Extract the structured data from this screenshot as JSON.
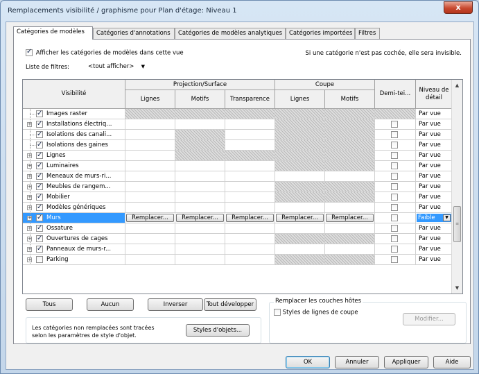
{
  "window": {
    "title": "Remplacements visibilité / graphisme pour Plan d'étage: Niveau 1",
    "close_glyph": "x"
  },
  "tabs": [
    {
      "label": "Catégories de modèles",
      "active": true
    },
    {
      "label": "Catégories d'annotations"
    },
    {
      "label": "Catégories de modèles analytiques"
    },
    {
      "label": "Catégories importées"
    },
    {
      "label": "Filtres"
    }
  ],
  "show_all": {
    "label": "Afficher les catégories de modèles dans cette vue",
    "checked": true
  },
  "hint": "Si une catégorie n'est pas cochée, elle sera invisible.",
  "filters": {
    "label": "Liste de filtres:",
    "value": "<tout afficher>"
  },
  "grid": {
    "headers": {
      "visibility": "Visibilité",
      "projection_group": "Projection/Surface",
      "cut_group": "Coupe",
      "lines": "Lignes",
      "patterns": "Motifs",
      "transparency": "Transparence",
      "cut_lines": "Lignes",
      "cut_patterns": "Motifs",
      "halftone": "Demi-tei...",
      "detail_level": "Niveau de détail"
    },
    "override_label": "Remplacer...",
    "rows": [
      {
        "name": "Images raster",
        "checked": true,
        "expandable": false,
        "detail": "Par vue",
        "hatch": [
          true,
          true,
          true,
          true,
          true,
          true
        ]
      },
      {
        "name": "Installations électriq...",
        "checked": true,
        "expandable": true,
        "detail": "Par vue",
        "hatch": [
          false,
          false,
          false,
          true,
          true,
          false
        ]
      },
      {
        "name": "Isolations des canali...",
        "checked": true,
        "expandable": false,
        "detail": "Par vue",
        "hatch": [
          false,
          true,
          false,
          true,
          true,
          false
        ]
      },
      {
        "name": "Isolations des gaines",
        "checked": true,
        "expandable": false,
        "detail": "Par vue",
        "hatch": [
          false,
          true,
          false,
          true,
          true,
          false
        ]
      },
      {
        "name": "Lignes",
        "checked": true,
        "expandable": true,
        "detail": "Par vue",
        "hatch": [
          false,
          true,
          true,
          true,
          true,
          false
        ]
      },
      {
        "name": "Luminaires",
        "checked": true,
        "expandable": true,
        "detail": "Par vue",
        "hatch": [
          false,
          false,
          false,
          true,
          true,
          false
        ]
      },
      {
        "name": "Meneaux de murs-ri...",
        "checked": true,
        "expandable": true,
        "detail": "Par vue",
        "hatch": [
          false,
          false,
          false,
          false,
          false,
          false
        ]
      },
      {
        "name": "Meubles de rangem...",
        "checked": true,
        "expandable": true,
        "detail": "Par vue",
        "hatch": [
          false,
          false,
          false,
          true,
          true,
          false
        ]
      },
      {
        "name": "Mobilier",
        "checked": true,
        "expandable": true,
        "detail": "Par vue",
        "hatch": [
          false,
          false,
          false,
          true,
          true,
          false
        ]
      },
      {
        "name": "Modèles génériques",
        "checked": true,
        "expandable": true,
        "detail": "Par vue",
        "hatch": [
          false,
          false,
          false,
          false,
          false,
          false
        ]
      },
      {
        "name": "Murs",
        "checked": true,
        "expandable": true,
        "detail": "Faible",
        "selected": true,
        "hatch": [
          false,
          false,
          false,
          false,
          false,
          false
        ]
      },
      {
        "name": "Ossature",
        "checked": true,
        "expandable": true,
        "detail": "Par vue",
        "hatch": [
          false,
          false,
          false,
          false,
          false,
          false
        ]
      },
      {
        "name": "Ouvertures de cages",
        "checked": true,
        "expandable": true,
        "detail": "Par vue",
        "hatch": [
          false,
          false,
          false,
          true,
          true,
          false
        ]
      },
      {
        "name": "Panneaux de murs-r...",
        "checked": true,
        "expandable": true,
        "detail": "Par vue",
        "hatch": [
          false,
          false,
          false,
          false,
          false,
          false
        ]
      },
      {
        "name": "Parking",
        "checked": false,
        "expandable": true,
        "detail": "Par vue",
        "hatch": [
          false,
          false,
          false,
          true,
          true,
          false
        ]
      }
    ]
  },
  "buttons": {
    "all": "Tous",
    "none": "Aucun",
    "invert": "Inverser",
    "expand_all": "Tout développer",
    "object_styles": "Styles d'objets...",
    "modify": "Modifier...",
    "ok": "OK",
    "cancel": "Annuler",
    "apply": "Appliquer",
    "help": "Aide"
  },
  "host_layers": {
    "title": "Remplacer les couches hôtes",
    "cut_line_styles": "Styles de lignes de coupe",
    "checked": false
  },
  "note": "Les catégories non remplacées sont tracées selon les paramètres de style d'objet."
}
